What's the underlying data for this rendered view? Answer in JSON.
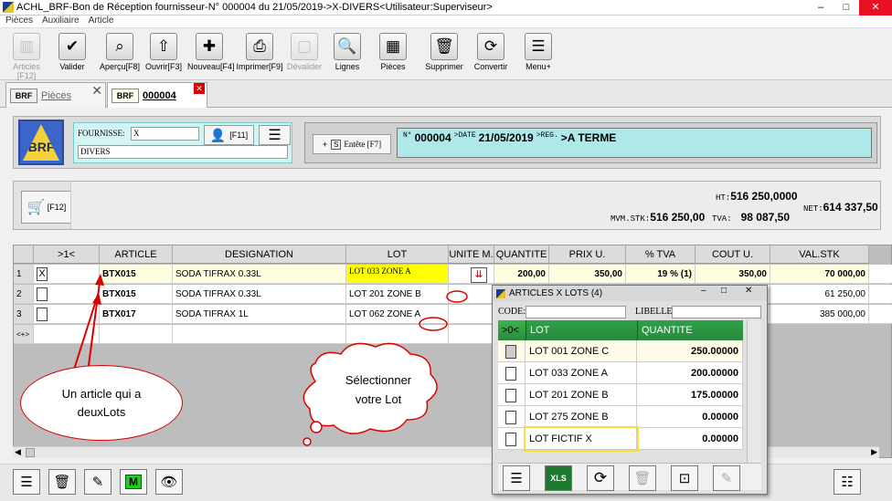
{
  "window": {
    "title": "ACHL_BRF-Bon de Réception fournisseur-N° 000004 du 21/05/2019->X-DIVERS<Utilisateur:Superviseur>",
    "menu": [
      "Pièces",
      "Auxiliaire",
      "Article"
    ],
    "controls": {
      "minimize": "–",
      "maximize": "□",
      "close": "✕"
    }
  },
  "toolbar": [
    {
      "label": "Articles [F12]",
      "icon": "barcode-icon",
      "glyph": "▥",
      "disabled": true
    },
    {
      "label": "Valider",
      "icon": "check-icon",
      "glyph": "✔",
      "disabled": false
    },
    {
      "label": "Aperçu[F8]",
      "icon": "preview-icon",
      "glyph": "⌕",
      "disabled": false
    },
    {
      "label": "Ouvrir[F3]",
      "icon": "open-icon",
      "glyph": "⇧",
      "disabled": false
    },
    {
      "label": "Nouveau[F4]",
      "icon": "new-icon",
      "glyph": "✚",
      "disabled": false
    },
    {
      "label": "Imprimer[F9]",
      "icon": "print-icon",
      "glyph": "⎙",
      "disabled": false
    },
    {
      "label": "Dévalider",
      "icon": "unvalidate-icon",
      "glyph": "▢",
      "disabled": true
    },
    {
      "label": "Lignes",
      "icon": "search-lines-icon",
      "glyph": "🔍",
      "disabled": false
    },
    {
      "label": "Pièces",
      "icon": "documents-icon",
      "glyph": "▦",
      "disabled": false
    },
    {
      "label": "Supprimer",
      "icon": "trash-icon",
      "glyph": "🗑",
      "disabled": false
    },
    {
      "label": "Convertir",
      "icon": "convert-icon",
      "glyph": "⟳",
      "disabled": false
    },
    {
      "label": "Menu+",
      "icon": "menu-icon",
      "glyph": "☰",
      "disabled": false
    }
  ],
  "tabs": {
    "pieces": {
      "badge": "BRF",
      "label": "Pièces",
      "close": "✕"
    },
    "doc": {
      "badge": "BRF",
      "label": "000004",
      "close": "✕"
    }
  },
  "header": {
    "logo_text": "BRF",
    "fournisseur_label": "FOURNISSE:",
    "fournisseur_code": "X",
    "fournisseur_name": "DIVERS",
    "f11_label": "[F11]",
    "entete_label": "Entête [F7]",
    "entete_s": "S",
    "numero_label": "N°",
    "numero": "000004",
    "date_label": ">DATE",
    "date": "21/05/2019",
    "reg_label": ">REG.",
    "reg": ">A TERME"
  },
  "totals": {
    "f12_label": "[F12]",
    "ht_label": "HT:",
    "ht": "516 250,0000",
    "mvm_label": "MVM.STK:",
    "mvm": "516 250,00",
    "tva_label": "TVA:",
    "tva": "98 087,50",
    "net_label": "NET:",
    "net": "614 337,50"
  },
  "grid": {
    "columns": [
      ">1<",
      "ARTICLE",
      "DESIGNATION",
      "LOT",
      "UNITE M.",
      "QUANTITE",
      "PRIX U.",
      "% TVA",
      "COUT U.",
      "VAL.STK"
    ],
    "rows": [
      {
        "n": "1",
        "check": "X",
        "article": "BTX015",
        "designation": "SODA TIFRAX 0.33L",
        "lot": "LOT 033 ZONE A",
        "unite": "",
        "quantite": "200,00",
        "prix": "350,00",
        "tva": "19 % (1)",
        "cout": "350,00",
        "valstk": "70 000,00"
      },
      {
        "n": "2",
        "check": "",
        "article": "BTX015",
        "designation": "SODA TIFRAX 0.33L",
        "lot": "LOT 201 ZONE B",
        "unite": "",
        "quantite": "",
        "prix": "",
        "tva": "",
        "cout": "",
        "valstk": "61 250,00"
      },
      {
        "n": "3",
        "check": "",
        "article": "BTX017",
        "designation": "SODA TIFRAX 1L",
        "lot": "LOT 062 ZONE A",
        "unite": "",
        "quantite": "",
        "prix": "",
        "tva": "",
        "cout": "",
        "valstk": "385 000,00"
      }
    ],
    "new_row_marker": "<+>"
  },
  "popup": {
    "title": "ARTICLES X LOTS (4)",
    "code_label": "CODE:",
    "libelle_label": "LIBELLE:",
    "columns": [
      ">0<",
      "LOT",
      "QUANTITE"
    ],
    "rows": [
      {
        "lot": "LOT 001 ZONE C",
        "quantite": "250.00000"
      },
      {
        "lot": "LOT 033 ZONE A",
        "quantite": "200.00000"
      },
      {
        "lot": "LOT 201 ZONE B",
        "quantite": "175.00000"
      },
      {
        "lot": "LOT 275 ZONE B",
        "quantite": "0.00000"
      },
      {
        "lot": "LOT FICTIF X",
        "quantite": "0.00000"
      }
    ],
    "xls_label": "XLS"
  },
  "annotations": {
    "left": "Un article qui a deuxLots",
    "cloud": "Sélectionner votre Lot"
  },
  "colors": {
    "accent_green": "#2a8a3d",
    "lot_highlight": "#ffff00",
    "annotation_red": "#d00000",
    "header_cyan": "#aee8e8"
  }
}
